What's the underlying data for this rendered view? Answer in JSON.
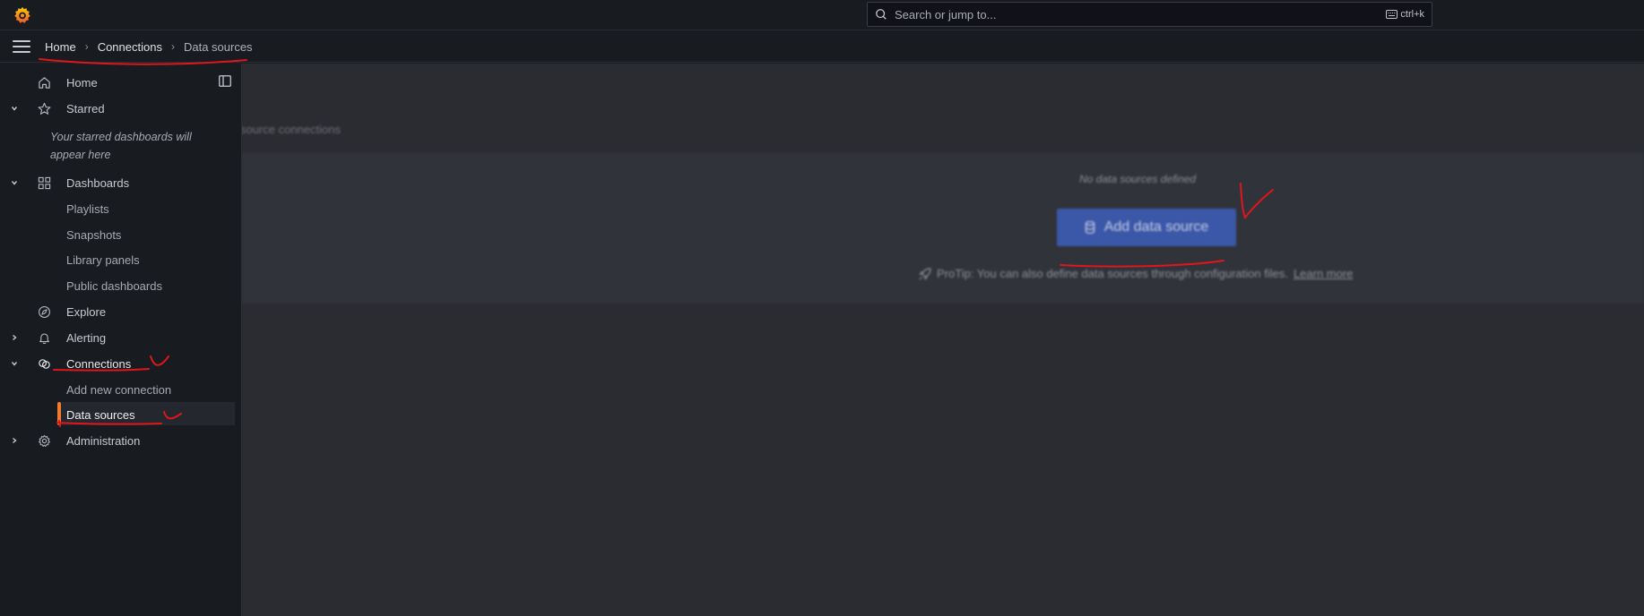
{
  "search": {
    "placeholder": "Search or jump to...",
    "shortcut": "ctrl+k"
  },
  "breadcrumb": {
    "items": [
      "Home",
      "Connections",
      "Data sources"
    ]
  },
  "sidebar": {
    "home": "Home",
    "starred": "Starred",
    "starred_empty": "Your starred dashboards will appear here",
    "dashboards": "Dashboards",
    "dashboards_children": [
      "Playlists",
      "Snapshots",
      "Library panels",
      "Public dashboards"
    ],
    "explore": "Explore",
    "alerting": "Alerting",
    "connections": "Connections",
    "connections_children": [
      "Add new connection",
      "Data sources"
    ],
    "administration": "Administration"
  },
  "main": {
    "subtitle": "source connections",
    "empty_title": "No data sources defined",
    "add_button": "Add data source",
    "protip_text": "ProTip: You can also define data sources through configuration files.",
    "protip_link": "Learn more"
  },
  "colors": {
    "accent": "#f17b2f",
    "primary_button": "#3b57a8",
    "annotation": "#e0161c"
  },
  "icons": [
    "grafana-logo",
    "search-icon",
    "keyboard-icon",
    "menu-icon",
    "home-icon",
    "star-icon",
    "apps-icon",
    "compass-icon",
    "bell-icon",
    "link-icon",
    "gear-icon",
    "database-icon",
    "rocket-icon",
    "dock-icon"
  ]
}
